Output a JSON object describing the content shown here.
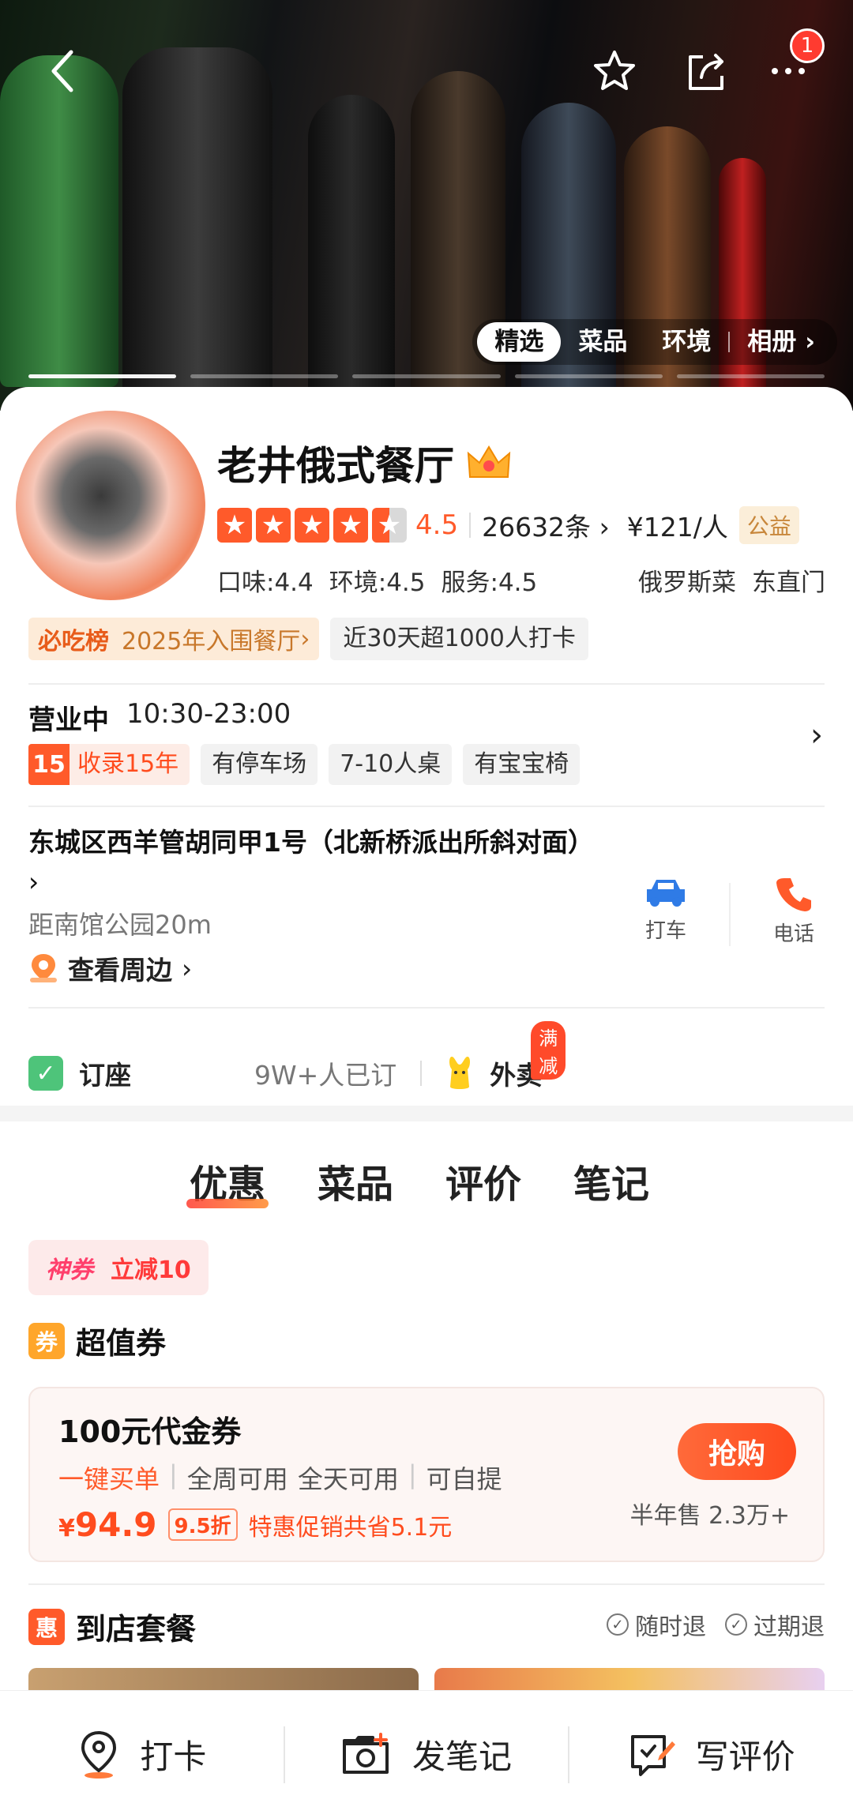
{
  "hero": {
    "tabs": [
      "精选",
      "菜品",
      "环境",
      "相册"
    ],
    "active_tab": 0,
    "notification_count": "1"
  },
  "shop": {
    "name": "老井俄式餐厅",
    "rating": "4.5",
    "review_count": "26632条",
    "price": "¥121/人",
    "gongyi": "公益",
    "scores": [
      "口味:4.4",
      "环境:4.5",
      "服务:4.5"
    ],
    "cuisine": "俄罗斯菜",
    "area": "东直门",
    "bichi_logo": "必吃榜",
    "bichi_text": "2025年入围餐厅",
    "checkin_tag": "近30天超1000人打卡",
    "status": "营业中",
    "hours": "10:30-23:00",
    "years_badge": "15",
    "years_text": "收录15年",
    "features": [
      "有停车场",
      "7-10人桌",
      "有宝宝椅"
    ],
    "address": "东城区西羊管胡同甲1号（北新桥派出所斜对面）",
    "distance": "距南馆公园20m",
    "nearby": "查看周边",
    "taxi": "打车",
    "phone": "电话",
    "booking": "订座",
    "booked": "9W+人已订",
    "takeout": "外卖",
    "takeout_badge": "满减"
  },
  "deals": {
    "tabs": [
      "优惠",
      "菜品",
      "评价",
      "笔记"
    ],
    "shenquan_label": "神券",
    "shenquan_value": "立减10",
    "voucher_section": "超值券",
    "voucher_icon": "券",
    "voucher": {
      "title": "100元代金券",
      "tag1": "一键买单",
      "tag2": "全周可用",
      "tag3": "全天可用",
      "tag4": "可自提",
      "currency": "¥",
      "price": "94.9",
      "discount": "9.5折",
      "saving": "特惠促销共省5.1元",
      "buy": "抢购",
      "sold": "半年售 2.3万+"
    },
    "package_section": "到店套餐",
    "package_icon": "惠",
    "refund1": "随时退",
    "refund2": "过期退"
  },
  "bottom": {
    "checkin": "打卡",
    "note": "发笔记",
    "review": "写评价"
  },
  "colors": {
    "accent": "#ff5a2a",
    "green": "#4ec47a",
    "blue": "#2f7be6"
  }
}
